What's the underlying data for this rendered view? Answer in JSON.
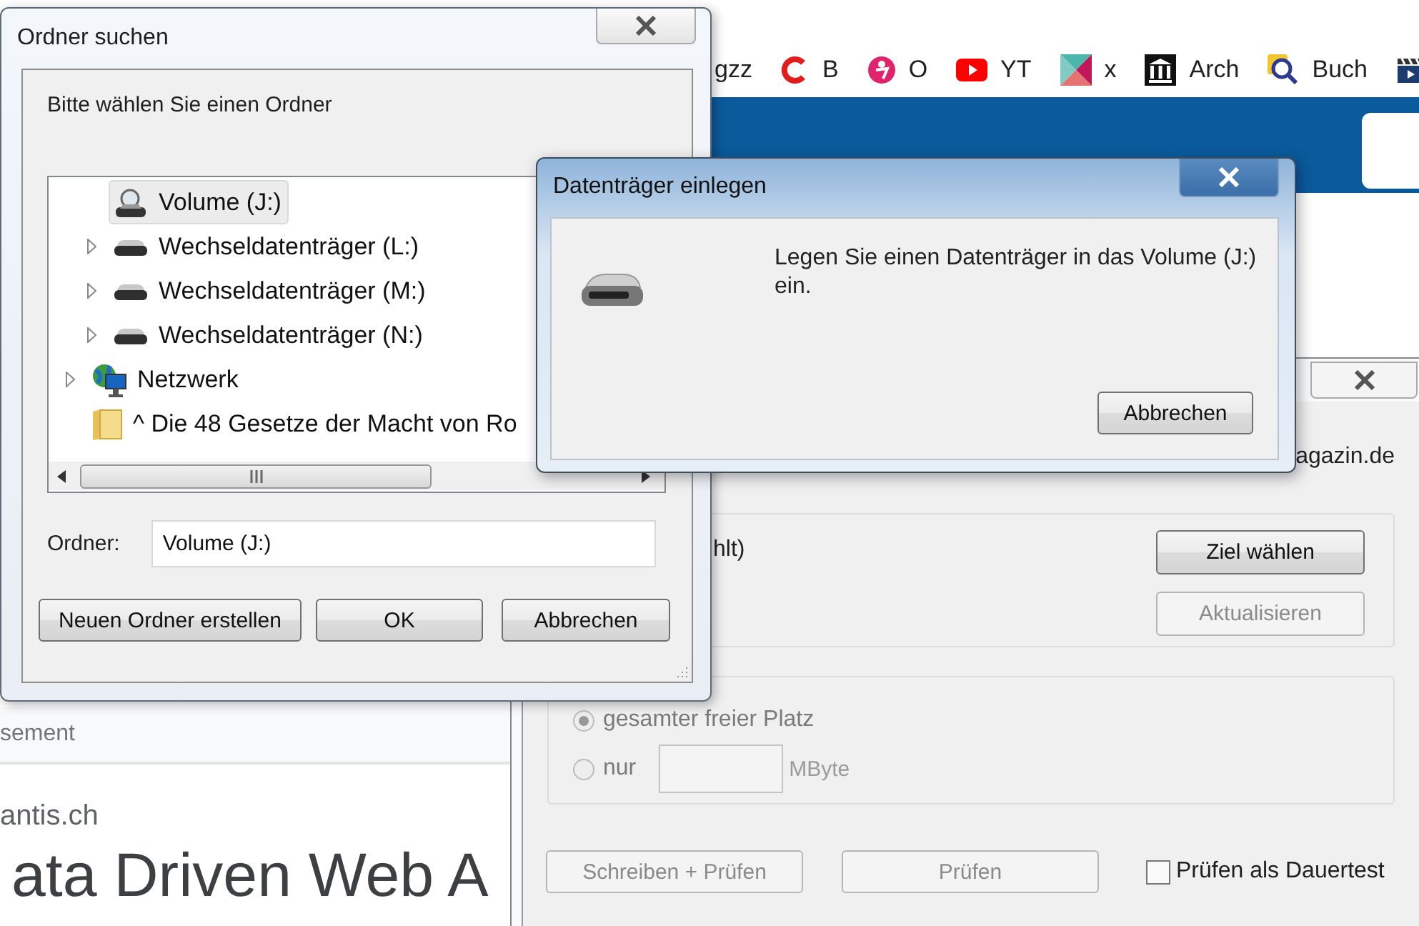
{
  "browser": {
    "bookmarks": [
      {
        "kind": "none",
        "label": "gzz"
      },
      {
        "kind": "ring",
        "label": "B"
      },
      {
        "kind": "circle",
        "label": "O"
      },
      {
        "kind": "play",
        "label": "YT"
      },
      {
        "kind": "triangles",
        "label": "x"
      },
      {
        "kind": "columns",
        "label": "Arch"
      },
      {
        "kind": "magnifier",
        "label": "Buch"
      },
      {
        "kind": "clapper"
      }
    ]
  },
  "page": {
    "ad_label": "sement",
    "site": "antis.ch",
    "headline": "ata Driven Web A"
  },
  "app_window": {
    "site_text": "agazin.de",
    "target_text": "hlt)",
    "buttons": [
      {
        "label": "Ziel wählen",
        "disabled": false
      },
      {
        "label": "Aktualisieren",
        "disabled": true
      }
    ],
    "size_options": [
      {
        "label": "gesamter freier Platz",
        "selected": true,
        "disabled": true
      },
      {
        "label": "nur",
        "selected": false,
        "disabled": true
      }
    ],
    "unit": "MByte",
    "actions": [
      {
        "label": "Schreiben + Prüfen",
        "disabled": true
      },
      {
        "label": "Prüfen",
        "disabled": true
      }
    ],
    "endless_test": {
      "label": "Prüfen als Dauertest",
      "checked": false
    }
  },
  "folder_dialog": {
    "title": "Ordner suchen",
    "prompt": "Bitte wählen Sie einen Ordner",
    "tree": [
      {
        "children": [
          {
            "label": "Volume (J:)",
            "kind": "volume",
            "expandable": false,
            "selected": true
          },
          {
            "label": "Wechseldatenträger (L:)",
            "kind": "removable",
            "expandable": true,
            "selected": false
          },
          {
            "label": "Wechseldatenträger (M:)",
            "kind": "removable",
            "expandable": true,
            "selected": false
          },
          {
            "label": "Wechseldatenträger (N:)",
            "kind": "removable",
            "expandable": true,
            "selected": false
          }
        ]
      },
      {
        "label": "Netzwerk",
        "kind": "network",
        "expandable": true,
        "selected": false
      },
      {
        "label": "^ Die 48 Gesetze der Macht von Ro",
        "kind": "folder",
        "expandable": false,
        "selected": false
      }
    ],
    "folder_label": "Ordner:",
    "folder_value": "Volume (J:)",
    "buttons": [
      "Neuen Ordner erstellen",
      "OK",
      "Abbrechen"
    ]
  },
  "insert_dialog": {
    "title": "Datenträger einlegen",
    "message": "Legen Sie einen Datenträger in das Volume (J:) ein.",
    "button": "Abbrechen"
  }
}
